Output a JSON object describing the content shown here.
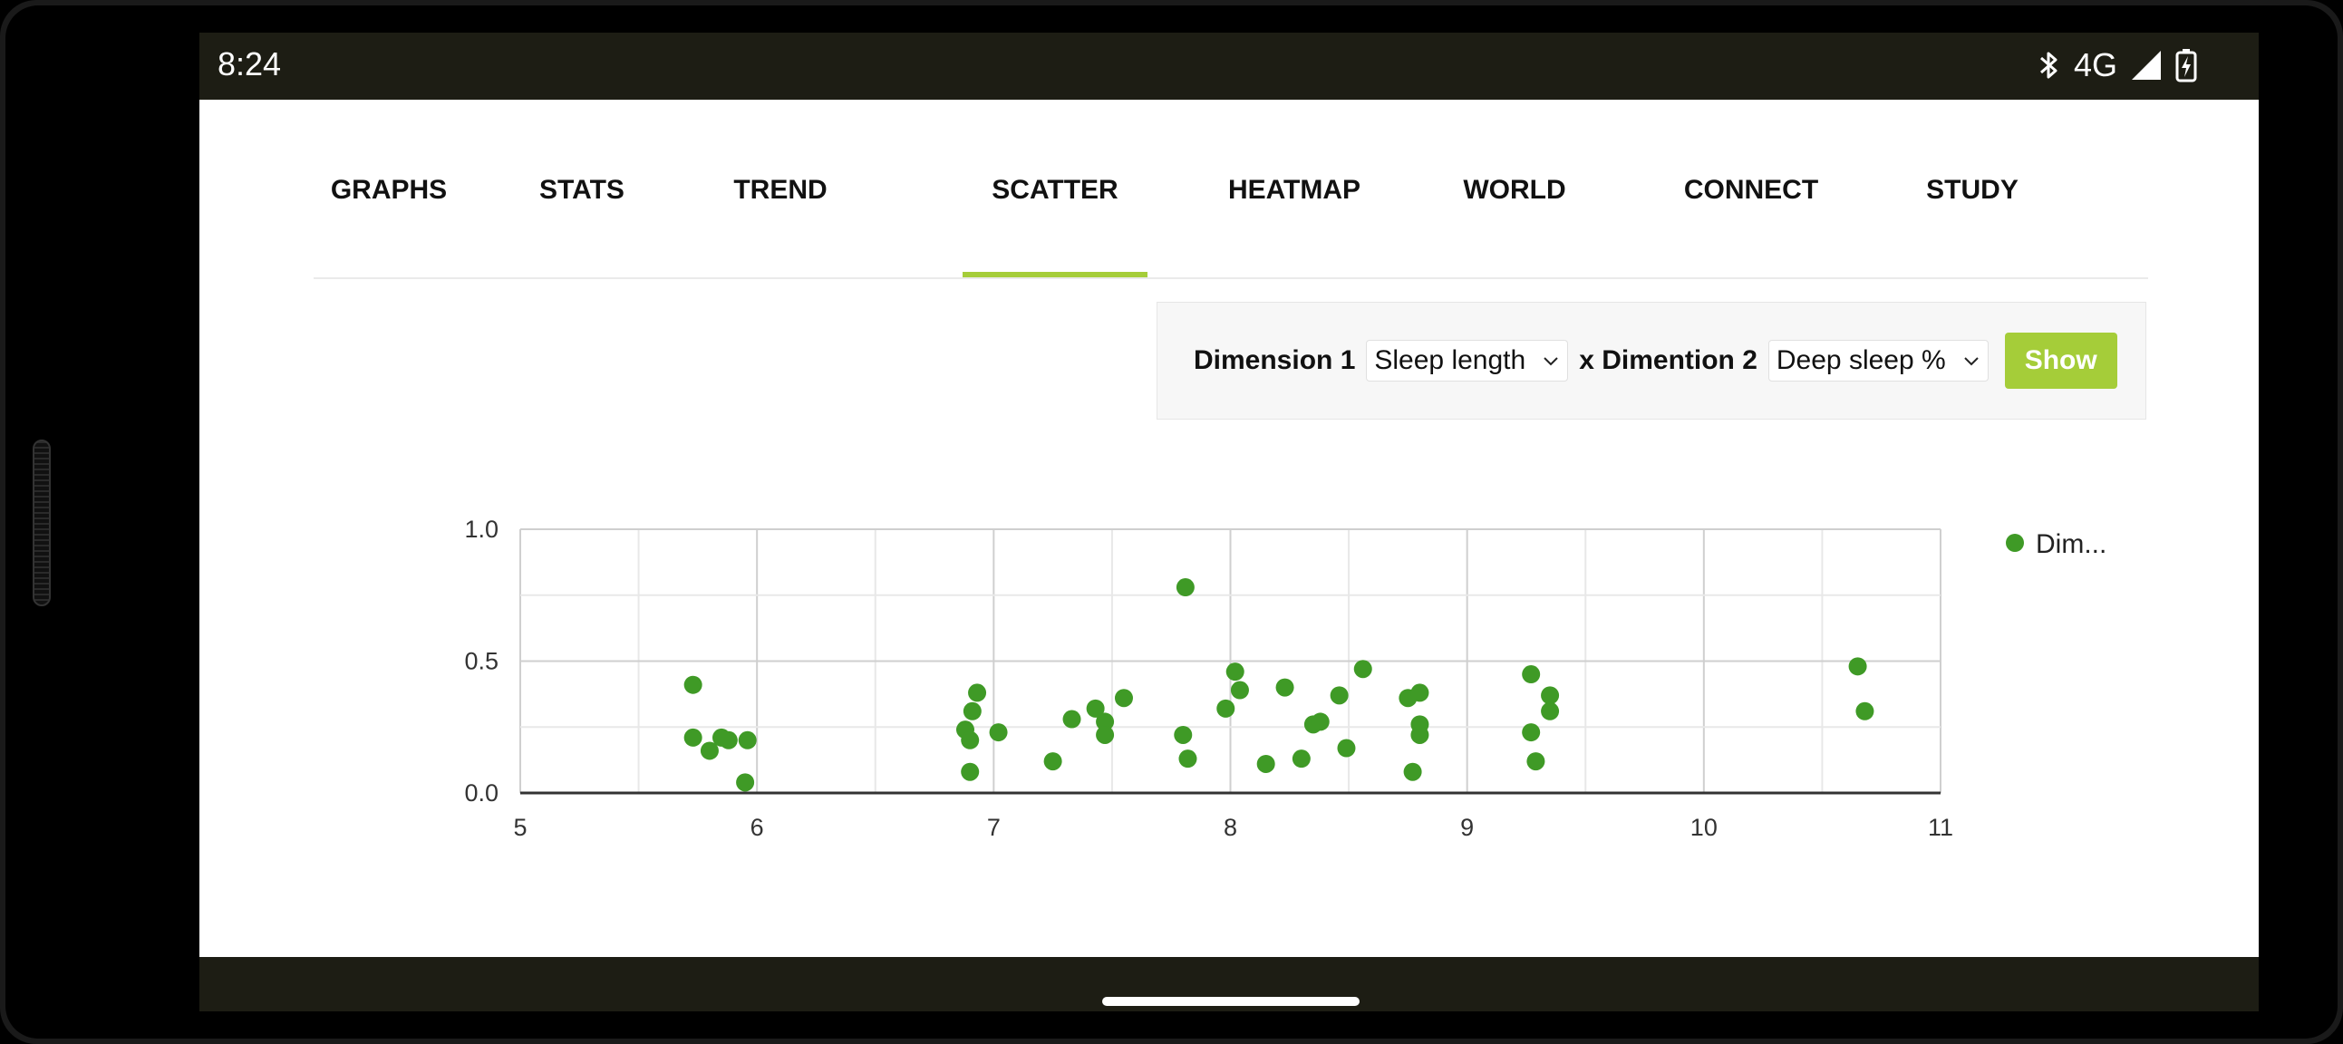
{
  "status": {
    "time": "8:24",
    "network": "4G"
  },
  "tabs": [
    {
      "label": "GRAPHS",
      "active": false
    },
    {
      "label": "STATS",
      "active": false
    },
    {
      "label": "TREND",
      "active": false
    },
    {
      "label": "SCATTER",
      "active": true
    },
    {
      "label": "HEATMAP",
      "active": false
    },
    {
      "label": "WORLD",
      "active": false
    },
    {
      "label": "CONNECT",
      "active": false
    },
    {
      "label": "STUDY",
      "active": false
    }
  ],
  "controls": {
    "dimension1_label": "Dimension 1",
    "dimension1_value": "Sleep length",
    "dimension2_label": "x Dimention 2",
    "dimension2_value": "Deep sleep %",
    "show_label": "Show"
  },
  "colors": {
    "accent": "#a5cd39",
    "point": "#3f9a26",
    "statusbar": "#1d1d14"
  },
  "chart_data": {
    "type": "scatter",
    "xlim": [
      5,
      11
    ],
    "ylim": [
      0,
      1
    ],
    "x_ticks": [
      "5",
      "6",
      "7",
      "8",
      "9",
      "10",
      "11"
    ],
    "y_ticks": [
      "0.0",
      "0.5",
      "1.0"
    ],
    "grid": true,
    "legend_position": "top-right",
    "series": [
      {
        "name": "Dim...",
        "points": [
          [
            5.73,
            0.41
          ],
          [
            5.73,
            0.21
          ],
          [
            5.8,
            0.16
          ],
          [
            5.85,
            0.21
          ],
          [
            5.88,
            0.2
          ],
          [
            5.96,
            0.2
          ],
          [
            5.95,
            0.04
          ],
          [
            6.88,
            0.24
          ],
          [
            6.9,
            0.2
          ],
          [
            6.91,
            0.31
          ],
          [
            6.93,
            0.38
          ],
          [
            6.9,
            0.08
          ],
          [
            7.02,
            0.23
          ],
          [
            7.25,
            0.12
          ],
          [
            7.33,
            0.28
          ],
          [
            7.43,
            0.32
          ],
          [
            7.47,
            0.27
          ],
          [
            7.47,
            0.22
          ],
          [
            7.55,
            0.36
          ],
          [
            7.8,
            0.22
          ],
          [
            7.81,
            0.78
          ],
          [
            7.82,
            0.13
          ],
          [
            7.98,
            0.32
          ],
          [
            8.02,
            0.46
          ],
          [
            8.04,
            0.39
          ],
          [
            8.15,
            0.11
          ],
          [
            8.23,
            0.4
          ],
          [
            8.3,
            0.13
          ],
          [
            8.35,
            0.26
          ],
          [
            8.38,
            0.27
          ],
          [
            8.46,
            0.37
          ],
          [
            8.49,
            0.17
          ],
          [
            8.56,
            0.47
          ],
          [
            8.75,
            0.36
          ],
          [
            8.77,
            0.08
          ],
          [
            8.8,
            0.38
          ],
          [
            8.8,
            0.26
          ],
          [
            8.8,
            0.22
          ],
          [
            9.27,
            0.45
          ],
          [
            9.27,
            0.23
          ],
          [
            9.29,
            0.12
          ],
          [
            9.35,
            0.37
          ],
          [
            9.35,
            0.31
          ],
          [
            10.65,
            0.48
          ],
          [
            10.68,
            0.31
          ]
        ]
      }
    ]
  }
}
